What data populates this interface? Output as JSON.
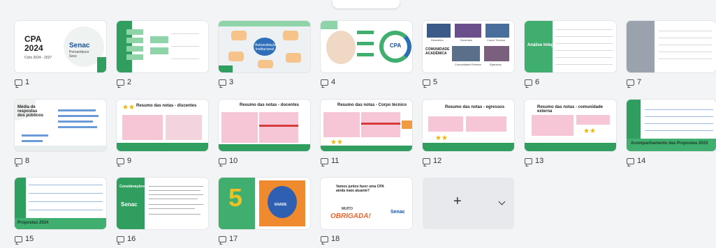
{
  "slides": [
    {
      "number": "1",
      "title": "CPA 2024",
      "subtitle": "Ciclo 2024 - 2027",
      "brand": "Senac",
      "brand_sub": "Pernambuco Sesc"
    },
    {
      "number": "2"
    },
    {
      "number": "3",
      "center": "Autoavaliação Institucional"
    },
    {
      "number": "4",
      "center": "CPA"
    },
    {
      "number": "5",
      "title": "COMUNIDADE ACADÊMICA",
      "captions": [
        "Discentes",
        "Docentes",
        "Corpo Técnico",
        "Comunidade Externa",
        "Egressos"
      ]
    },
    {
      "number": "6",
      "title": "Análise Integral"
    },
    {
      "number": "7"
    },
    {
      "number": "8",
      "title": "Média de respostas dos públicos"
    },
    {
      "number": "9",
      "title": "Resumo das notas - discentes"
    },
    {
      "number": "10",
      "title": "Resumo das notas - docentes"
    },
    {
      "number": "11",
      "title": "Resumo das notas - Corpo técnico"
    },
    {
      "number": "12",
      "title": "Resumo das notas - egressos"
    },
    {
      "number": "13",
      "title": "Resumo das notas - comunidade externa"
    },
    {
      "number": "14",
      "title": "Acompanhamento das Propostas 2023"
    },
    {
      "number": "15",
      "title": "Propostas 2024"
    },
    {
      "number": "16",
      "title": "Considerações",
      "brand": "Senac"
    },
    {
      "number": "17",
      "big": "5",
      "badge": "ENADE"
    },
    {
      "number": "18",
      "title": "Vamos juntos fazer uma CPA ainda mais atuante?",
      "thanks_a": "MUITO",
      "thanks_b": "OBRIGADA!",
      "brand": "Senac"
    }
  ],
  "add_slide": {
    "plus": "+",
    "icon": "chevron-down-icon"
  }
}
